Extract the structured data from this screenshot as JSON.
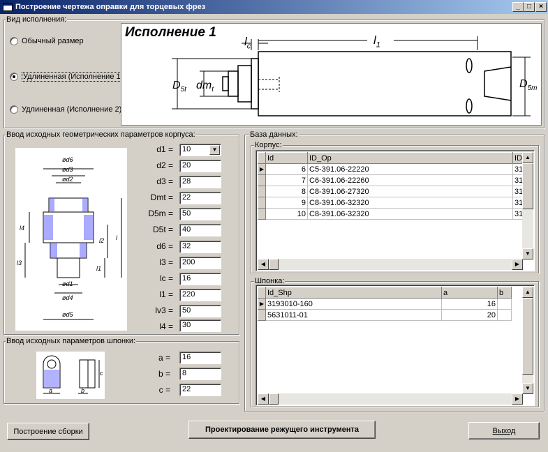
{
  "window": {
    "title": "Построение чертежа оправки для торцевых фрез",
    "minimize": "_",
    "maximize": "□",
    "close": "×"
  },
  "variant_group": {
    "label": "Вид исполнения:",
    "options": [
      "Обычный размер",
      "Удлиненная (Исполнение 1)",
      "Удлиненная (Исполнение 2)"
    ],
    "selected_index": 1
  },
  "drawing": {
    "title": "Исполнение 1",
    "lc_l": "l",
    "lc_sub": "c",
    "l1_l": "l",
    "l1_sub": "1",
    "d5t_l": "D",
    "d5t_sub": "5t",
    "dmt_l": "dm",
    "dmt_sub": "t",
    "d5m_l": "D",
    "d5m_sub": "5m"
  },
  "body_params": {
    "label": "Ввод исходных геометрических параметров корпуса:",
    "fields": [
      {
        "label": "d1 =",
        "value": "10",
        "combo": true
      },
      {
        "label": "d2 =",
        "value": "20"
      },
      {
        "label": "d3 =",
        "value": "28"
      },
      {
        "label": "Dmt =",
        "value": "22"
      },
      {
        "label": "D5m =",
        "value": "50"
      },
      {
        "label": "D5t =",
        "value": "40"
      },
      {
        "label": "d6 =",
        "value": "32"
      },
      {
        "label": "l3 =",
        "value": "200"
      },
      {
        "label": "lc =",
        "value": "16"
      },
      {
        "label": "l1 =",
        "value": "220"
      },
      {
        "label": "lv3 =",
        "value": "50"
      },
      {
        "label": "l4 =",
        "value": "30"
      }
    ],
    "sketch_labels": {
      "d6": "ød6",
      "d3": "ød3",
      "d2": "ød2",
      "d1": "ød1",
      "d4": "ød4",
      "d5": "ød5",
      "l4": "l4",
      "l3": "l3",
      "l2": "l2",
      "l1": "l1",
      "l": "l"
    }
  },
  "key_params": {
    "label": "Ввод исходных параметров шпонки:",
    "fields": [
      {
        "label": "a =",
        "value": "16"
      },
      {
        "label": "b =",
        "value": "8"
      },
      {
        "label": "c =",
        "value": "22"
      }
    ],
    "sketch_labels": {
      "a": "a",
      "b": "b",
      "c": "c"
    }
  },
  "database": {
    "label": "База данных:",
    "body_table": {
      "label": "Корпус:",
      "columns": [
        "Id",
        "ID_Op",
        "ID_"
      ],
      "rows": [
        {
          "id": "6",
          "id_op": "C5-391.06-22220",
          "x": "31"
        },
        {
          "id": "7",
          "id_op": "C6-391.06-22260",
          "x": "31"
        },
        {
          "id": "8",
          "id_op": "C8-391.06-27320",
          "x": "31"
        },
        {
          "id": "9",
          "id_op": "C8-391.06-32320",
          "x": "31"
        },
        {
          "id": "10",
          "id_op": "C8-391.06-32320",
          "x": "31"
        }
      ]
    },
    "key_table": {
      "label": "Шпонка:",
      "columns": [
        "Id_Shp",
        "a",
        "b"
      ],
      "rows": [
        {
          "id_shp": "3193010-160",
          "a": "16",
          "b": ""
        },
        {
          "id_shp": "5631011-01",
          "a": "20",
          "b": ""
        }
      ]
    }
  },
  "buttons": {
    "build_assembly": "Построение сборки",
    "design_tool": "Проектирование режущего инструмента",
    "exit": "Выход"
  }
}
